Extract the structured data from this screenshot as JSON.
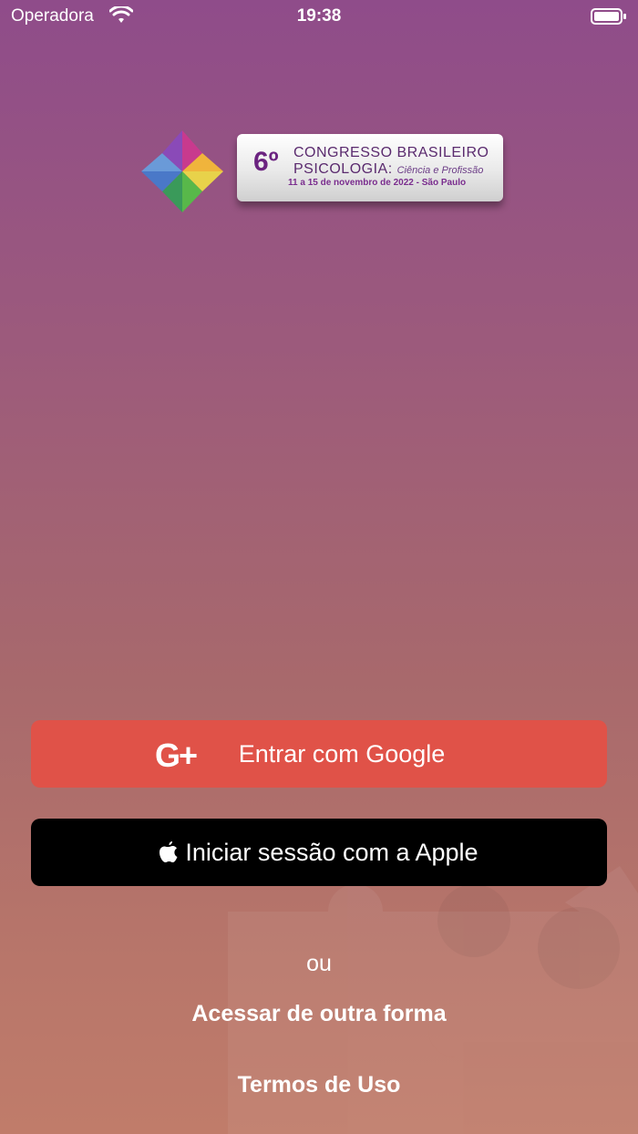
{
  "status_bar": {
    "carrier": "Operadora",
    "time": "19:38",
    "wifi_icon": "wifi-icon",
    "battery_icon": "battery-icon"
  },
  "logo": {
    "number": "6º",
    "line1": "CONGRESSO BRASILEIRO",
    "line2": "PSICOLOGIA:",
    "line2_sub": "Ciência e Profissão",
    "dates": "11 a 15 de novembro de 2022 - São Paulo",
    "icon": "pinwheel-icon"
  },
  "buttons": {
    "google_icon_text": "G+",
    "google_label": "Entrar com Google",
    "apple_label": "Iniciar sessão com a Apple"
  },
  "or_text": "ou",
  "alt_access": "Acessar de outra forma",
  "terms": "Termos de Uso",
  "colors": {
    "google_button": "#e05248",
    "apple_button": "#000000",
    "background_top": "#8f4c8a",
    "background_bottom": "#c07c6a"
  }
}
